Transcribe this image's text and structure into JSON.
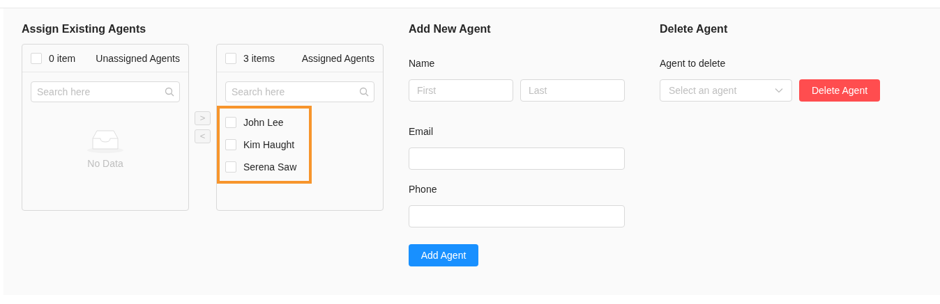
{
  "assign": {
    "title": "Assign Existing Agents",
    "source": {
      "checked": false,
      "count": "0 item",
      "title": "Unassigned Agents",
      "search_placeholder": "Search here",
      "empty_text": "No Data"
    },
    "actions": [
      {
        "label": ">",
        "disabled": true
      },
      {
        "label": "<",
        "disabled": true
      }
    ],
    "target": {
      "checked": false,
      "count": "3 items",
      "title": "Assigned Agents",
      "search_placeholder": "Search here",
      "highlighted": true,
      "items": [
        {
          "label": "John Lee",
          "checked": false
        },
        {
          "label": "Kim Haught",
          "checked": false
        },
        {
          "label": "Serena Saw",
          "checked": false
        }
      ]
    }
  },
  "add_agent": {
    "title": "Add New Agent",
    "name_label": "Name",
    "first_placeholder": "First",
    "last_placeholder": "Last",
    "email_label": "Email",
    "phone_label": "Phone",
    "button": "Add Agent"
  },
  "delete_agent": {
    "title": "Delete Agent",
    "label": "Agent to delete",
    "select_placeholder": "Select an agent",
    "button": "Delete Agent"
  }
}
